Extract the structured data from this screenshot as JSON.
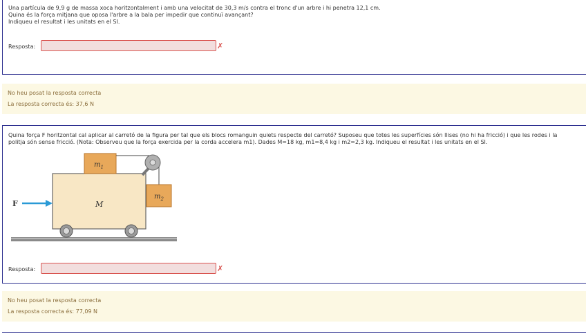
{
  "q1": {
    "lines": [
      "Una partícula de 9,9 g de massa xoca horitzontalment i amb una velocitat de 30,3 m/s contra el tronc d'un arbre i hi penetra 12,1 cm.",
      "Quina és la força mitjana que oposa l'arbre a la bala per impedir que continuï avançant?",
      "Indiqueu el resultat i les unitats en el SI."
    ],
    "answer_label": "Resposta:",
    "answer_value": "",
    "incorrect_mark": "✗"
  },
  "fb1": {
    "status": "No heu posat la resposta correcta",
    "correct": "La resposta correcta és: 37,6 N"
  },
  "q2": {
    "text": "Quina força F horitzontal cal aplicar al carretó de la figura per tal que els blocs romanguin quiets respecte del carretó? Suposeu que totes les superfícies són llises (no hi ha fricció) i que les rodes i la politja són sense fricció. (Nota: Observeu que la força exercida per la corda accelera m1). Dades M=18 kg, m1=8,4 kg i m2=2,3 kg. Indiqueu el resultat i les unitats en el SI.",
    "figure": {
      "label_m1": "m",
      "label_m1_sub": "1",
      "label_m2": "m",
      "label_m2_sub": "2",
      "label_M": "M",
      "label_F": "F"
    },
    "answer_label": "Resposta:",
    "answer_value": "",
    "incorrect_mark": "✗"
  },
  "fb2": {
    "status": "No heu posat la resposta correcta",
    "correct": "La resposta correcta és: 77,09 N"
  },
  "colors": {
    "accent_border": "#2c2f8f",
    "feedback_bg": "#fcf8e3",
    "feedback_text": "#8a6d3b",
    "error_border": "#d9534f",
    "error_bg": "#f2dede",
    "block_orange": "#e8a85a",
    "cart_fill": "#f8e7c5",
    "arrow_blue": "#2a9ad6"
  }
}
